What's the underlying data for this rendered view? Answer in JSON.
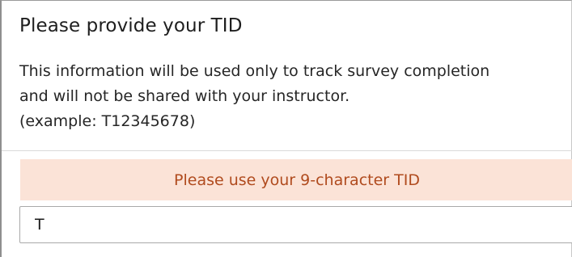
{
  "question": {
    "title": "Please provide your TID",
    "description_lines": [
      "This information will be used only to track survey completion",
      "and will not be shared with your instructor.",
      "(example: T12345678)"
    ]
  },
  "validation": {
    "message": "Please use your 9-character TID"
  },
  "tid_field": {
    "value": "T",
    "placeholder": ""
  },
  "colors": {
    "banner_background": "#fbe3d7",
    "banner_text": "#b04b1e"
  }
}
